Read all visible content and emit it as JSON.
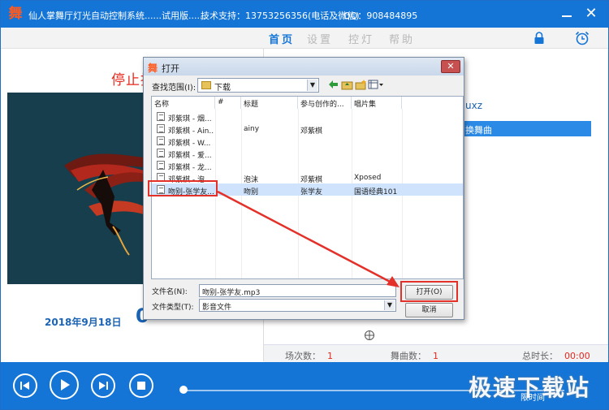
{
  "app": {
    "title": "仙人掌舞厅灯光自动控制系统......试用版......",
    "support": "技术支持：13753256356(电话及微信)",
    "qq": "QQ：908484895",
    "logo_glyph": "舞"
  },
  "menu": [
    {
      "label": "首页",
      "active": true
    },
    {
      "label": "设置",
      "active": false
    },
    {
      "label": "控灯",
      "active": false
    },
    {
      "label": "帮助",
      "active": false
    }
  ],
  "left": {
    "status_text": "停止播",
    "date": "2018年9月18日",
    "time_fragment": "0"
  },
  "right": {
    "header_fragment": "uxz",
    "row_fragment": "换舞曲"
  },
  "stats": {
    "session_label": "场次数：",
    "session_value": "1",
    "songs_label": "舞曲数：",
    "songs_value": "1",
    "total_label": "总时长：",
    "total_value": "00:00"
  },
  "watermark": {
    "text": "极速下载站",
    "sub": "限时间"
  },
  "dialog": {
    "title": "打开",
    "lookin_label": "查找范围(I):",
    "lookin_value": "下载",
    "columns": [
      "名称",
      "#",
      "标题",
      "参与创作的...",
      "唱片集"
    ],
    "files": [
      {
        "name": "邓紫琪 - 烟...",
        "num": "",
        "title": "",
        "artist": "",
        "album": "",
        "selected": false
      },
      {
        "name": "邓紫棋 - Ain...",
        "num": "",
        "title": "ainy",
        "artist": "邓紫棋",
        "album": "",
        "selected": false
      },
      {
        "name": "邓紫棋 - W...",
        "num": "",
        "title": "",
        "artist": "",
        "album": "",
        "selected": false
      },
      {
        "name": "邓紫棋 - 爱...",
        "num": "",
        "title": "",
        "artist": "",
        "album": "",
        "selected": false
      },
      {
        "name": "邓紫棋 - 龙...",
        "num": "",
        "title": "",
        "artist": "",
        "album": "",
        "selected": false
      },
      {
        "name": "邓紫棋 - 泡...",
        "num": "",
        "title": "泡沫",
        "artist": "邓紫棋",
        "album": "Xposed",
        "selected": false
      },
      {
        "name": "吻别-张学友...",
        "num": "",
        "title": "吻别",
        "artist": "张学友",
        "album": "国语经典101",
        "selected": true
      }
    ],
    "filename_label": "文件名(N):",
    "filename_value": "吻别-张学友.mp3",
    "filetype_label": "文件类型(T):",
    "filetype_value": "影音文件",
    "open_label": "打开(O)",
    "cancel_label": "取消"
  },
  "colors": {
    "brand_blue": "#1475d6",
    "accent_red": "#e8271d",
    "highlight": "#e3312a"
  }
}
